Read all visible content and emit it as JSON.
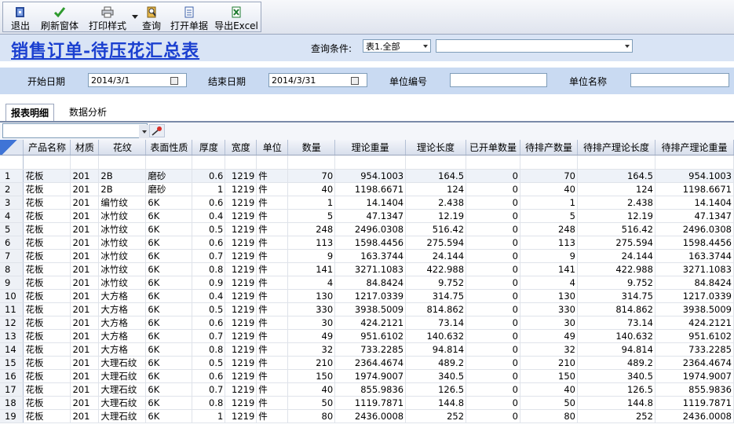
{
  "toolbar": {
    "buttons": [
      {
        "label": "退出",
        "icon": "exit-icon"
      },
      {
        "label": "刷新窗体",
        "icon": "refresh-check-icon"
      },
      {
        "label": "打印样式",
        "icon": "printer-icon"
      },
      {
        "label": "查询",
        "icon": "query-icon"
      },
      {
        "label": "打开单据",
        "icon": "document-icon"
      },
      {
        "label": "导出Excel",
        "icon": "excel-icon"
      }
    ]
  },
  "header": {
    "title": "销售订单-待压花汇总表",
    "query_label": "查询条件:",
    "query_value": "表1.全部",
    "query_value2": ""
  },
  "filter": {
    "start_label": "开始日期",
    "start_value": "2014/3/1",
    "end_label": "结束日期",
    "end_value": "2014/3/31",
    "unit_code_label": "单位编号",
    "unit_code_value": "",
    "unit_name_label": "单位名称",
    "unit_name_value": ""
  },
  "tabs": [
    "报表明细",
    "数据分析"
  ],
  "grid": {
    "columns": [
      "产品名称",
      "材质",
      "花纹",
      "表面性质",
      "厚度",
      "宽度",
      "单位",
      "数量",
      "理论重量",
      "理论长度",
      "已开单数量",
      "待排产数量",
      "待排产理论长度",
      "待排产理论重量"
    ],
    "rows": [
      [
        "1",
        "花板",
        "201",
        "2B",
        "磨砂",
        "0.6",
        "1219",
        "件",
        "70",
        "954.1003",
        "164.5",
        "0",
        "70",
        "164.5",
        "954.1003"
      ],
      [
        "2",
        "花板",
        "201",
        "2B",
        "磨砂",
        "1",
        "1219",
        "件",
        "40",
        "1198.6671",
        "124",
        "0",
        "40",
        "124",
        "1198.6671"
      ],
      [
        "3",
        "花板",
        "201",
        "编竹纹",
        "6K",
        "0.6",
        "1219",
        "件",
        "1",
        "14.1404",
        "2.438",
        "0",
        "1",
        "2.438",
        "14.1404"
      ],
      [
        "4",
        "花板",
        "201",
        "冰竹纹",
        "6K",
        "0.4",
        "1219",
        "件",
        "5",
        "47.1347",
        "12.19",
        "0",
        "5",
        "12.19",
        "47.1347"
      ],
      [
        "5",
        "花板",
        "201",
        "冰竹纹",
        "6K",
        "0.5",
        "1219",
        "件",
        "248",
        "2496.0308",
        "516.42",
        "0",
        "248",
        "516.42",
        "2496.0308"
      ],
      [
        "6",
        "花板",
        "201",
        "冰竹纹",
        "6K",
        "0.6",
        "1219",
        "件",
        "113",
        "1598.4456",
        "275.594",
        "0",
        "113",
        "275.594",
        "1598.4456"
      ],
      [
        "7",
        "花板",
        "201",
        "冰竹纹",
        "6K",
        "0.7",
        "1219",
        "件",
        "9",
        "163.3744",
        "24.144",
        "0",
        "9",
        "24.144",
        "163.3744"
      ],
      [
        "8",
        "花板",
        "201",
        "冰竹纹",
        "6K",
        "0.8",
        "1219",
        "件",
        "141",
        "3271.1083",
        "422.988",
        "0",
        "141",
        "422.988",
        "3271.1083"
      ],
      [
        "9",
        "花板",
        "201",
        "冰竹纹",
        "6K",
        "0.9",
        "1219",
        "件",
        "4",
        "84.8424",
        "9.752",
        "0",
        "4",
        "9.752",
        "84.8424"
      ],
      [
        "10",
        "花板",
        "201",
        "大方格",
        "6K",
        "0.4",
        "1219",
        "件",
        "130",
        "1217.0339",
        "314.75",
        "0",
        "130",
        "314.75",
        "1217.0339"
      ],
      [
        "11",
        "花板",
        "201",
        "大方格",
        "6K",
        "0.5",
        "1219",
        "件",
        "330",
        "3938.5009",
        "814.862",
        "0",
        "330",
        "814.862",
        "3938.5009"
      ],
      [
        "12",
        "花板",
        "201",
        "大方格",
        "6K",
        "0.6",
        "1219",
        "件",
        "30",
        "424.2121",
        "73.14",
        "0",
        "30",
        "73.14",
        "424.2121"
      ],
      [
        "13",
        "花板",
        "201",
        "大方格",
        "6K",
        "0.7",
        "1219",
        "件",
        "49",
        "951.6102",
        "140.632",
        "0",
        "49",
        "140.632",
        "951.6102"
      ],
      [
        "14",
        "花板",
        "201",
        "大方格",
        "6K",
        "0.8",
        "1219",
        "件",
        "32",
        "733.2285",
        "94.814",
        "0",
        "32",
        "94.814",
        "733.2285"
      ],
      [
        "15",
        "花板",
        "201",
        "大理石纹",
        "6K",
        "0.5",
        "1219",
        "件",
        "210",
        "2364.4674",
        "489.2",
        "0",
        "210",
        "489.2",
        "2364.4674"
      ],
      [
        "16",
        "花板",
        "201",
        "大理石纹",
        "6K",
        "0.6",
        "1219",
        "件",
        "150",
        "1974.9007",
        "340.5",
        "0",
        "150",
        "340.5",
        "1974.9007"
      ],
      [
        "17",
        "花板",
        "201",
        "大理石纹",
        "6K",
        "0.7",
        "1219",
        "件",
        "40",
        "855.9836",
        "126.5",
        "0",
        "40",
        "126.5",
        "855.9836"
      ],
      [
        "18",
        "花板",
        "201",
        "大理石纹",
        "6K",
        "0.8",
        "1219",
        "件",
        "50",
        "1119.7871",
        "144.8",
        "0",
        "50",
        "144.8",
        "1119.7871"
      ],
      [
        "19",
        "花板",
        "201",
        "大理石纹",
        "6K",
        "1",
        "1219",
        "件",
        "80",
        "2436.0008",
        "252",
        "0",
        "80",
        "252",
        "2436.0008"
      ]
    ]
  }
}
